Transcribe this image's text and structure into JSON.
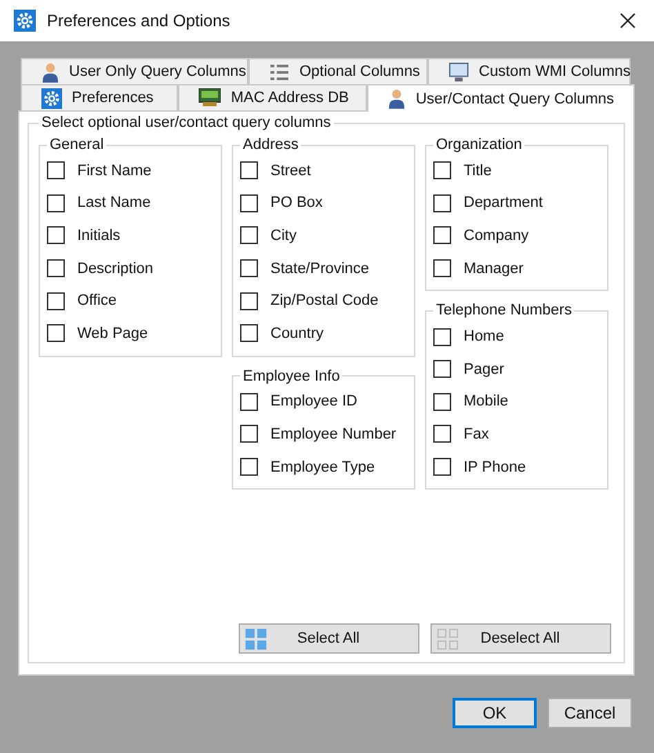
{
  "window": {
    "title": "Preferences and Options"
  },
  "tab_rows": [
    [
      {
        "label": "User Only Query Columns",
        "kind": "user",
        "selected": false
      },
      {
        "label": "Optional Columns",
        "kind": "list",
        "selected": false
      },
      {
        "label": "Custom WMI Columns",
        "kind": "monitor",
        "selected": false
      }
    ],
    [
      {
        "label": "Preferences",
        "kind": "gear",
        "selected": false
      },
      {
        "label": "MAC Address DB",
        "kind": "network",
        "selected": false
      },
      {
        "label": "User/Contact Query Columns",
        "kind": "user",
        "selected": true
      }
    ]
  ],
  "panel": {
    "title": "Select optional user/contact query columns",
    "columns": [
      [
        {
          "title": "General",
          "items": [
            {
              "label": "First Name",
              "checked": false
            },
            {
              "label": "Last Name",
              "checked": false
            },
            {
              "label": "Initials",
              "checked": false
            },
            {
              "label": "Description",
              "checked": false
            },
            {
              "label": "Office",
              "checked": false
            },
            {
              "label": "Web Page",
              "checked": false
            }
          ]
        }
      ],
      [
        {
          "title": "Address",
          "items": [
            {
              "label": "Street",
              "checked": false
            },
            {
              "label": "PO Box",
              "checked": false
            },
            {
              "label": "City",
              "checked": false
            },
            {
              "label": "State/Province",
              "checked": false
            },
            {
              "label": "Zip/Postal Code",
              "checked": false
            },
            {
              "label": "Country",
              "checked": false
            }
          ]
        },
        {
          "title": "Employee Info",
          "items": [
            {
              "label": "Employee ID",
              "checked": false
            },
            {
              "label": "Employee Number",
              "checked": false
            },
            {
              "label": "Employee Type",
              "checked": false
            }
          ]
        }
      ],
      [
        {
          "title": "Organization",
          "items": [
            {
              "label": "Title",
              "checked": false
            },
            {
              "label": "Department",
              "checked": false
            },
            {
              "label": "Company",
              "checked": false
            },
            {
              "label": "Manager",
              "checked": false
            }
          ]
        },
        {
          "title": "Telephone Numbers",
          "items": [
            {
              "label": "Home",
              "checked": false
            },
            {
              "label": "Pager",
              "checked": false
            },
            {
              "label": "Mobile",
              "checked": false
            },
            {
              "label": "Fax",
              "checked": false
            },
            {
              "label": "IP Phone",
              "checked": false
            }
          ]
        }
      ]
    ],
    "actions": [
      {
        "label": "Select All",
        "kind": "select"
      },
      {
        "label": "Deselect All",
        "kind": "deselect"
      }
    ]
  },
  "buttons": [
    {
      "label": "OK",
      "kind": "default"
    },
    {
      "label": "Cancel",
      "kind": "normal"
    }
  ]
}
